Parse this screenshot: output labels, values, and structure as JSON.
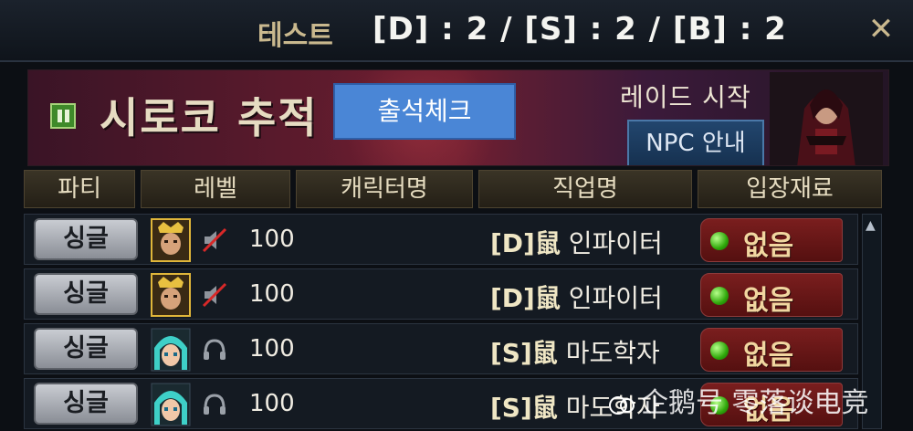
{
  "window": {
    "title": "테스트",
    "counts": "[D] : 2 / [S] : 2 / [B] : 2",
    "close_icon": "close-icon"
  },
  "banner": {
    "raid_name": "시로코 추적",
    "attendance_button": "출석체크",
    "raid_start_label": "레이드 시작",
    "npc_guide_button": "NPC 안내"
  },
  "table": {
    "headers": [
      "파티",
      "레벨",
      "캐릭터명",
      "직업명",
      "입장재료"
    ],
    "rows": [
      {
        "party": "싱글",
        "status_icon": "muted-speaker-icon",
        "level": "100",
        "character_name": "",
        "tier": "[D]",
        "job": "인파이터",
        "material": "없음"
      },
      {
        "party": "싱글",
        "status_icon": "muted-speaker-icon",
        "level": "100",
        "character_name": "",
        "tier": "[D]",
        "job": "인파이터",
        "material": "없음"
      },
      {
        "party": "싱글",
        "status_icon": "headset-icon",
        "level": "100",
        "character_name": "",
        "tier": "[S]",
        "job": "마도학자",
        "material": "없음"
      },
      {
        "party": "싱글",
        "status_icon": "headset-icon",
        "level": "100",
        "character_name": "",
        "tier": "[S]",
        "job": "마도학자",
        "material": "없음"
      }
    ]
  },
  "watermark": {
    "text": "企鹅号 零落谈电竞"
  },
  "colors": {
    "accent_gold": "#c9b88e",
    "button_blue": "#4a86d6",
    "material_red": "#6b1a1a",
    "ready_green": "#2fa80a"
  }
}
